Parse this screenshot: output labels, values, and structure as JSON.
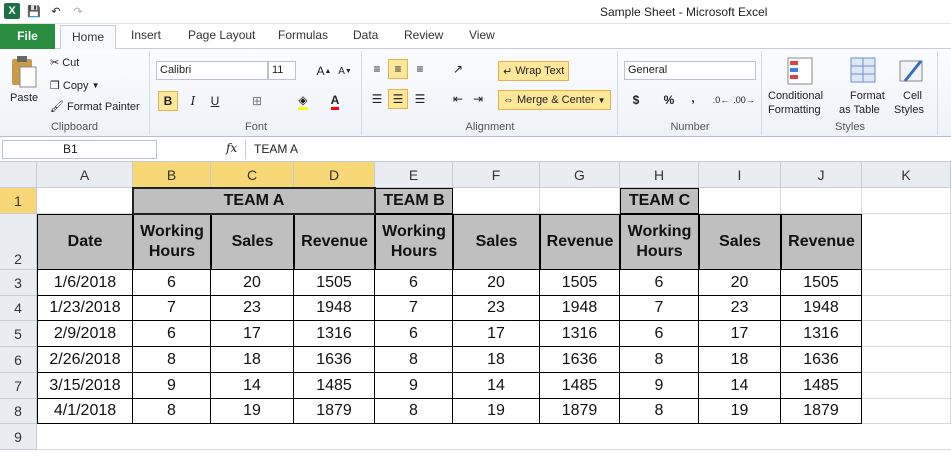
{
  "window": {
    "title": "Sample Sheet  -  Microsoft Excel"
  },
  "qat": {
    "logo": "X",
    "save": "💾",
    "undo": "↶",
    "redo": "↷"
  },
  "tabs": [
    "File",
    "Home",
    "Insert",
    "Page Layout",
    "Formulas",
    "Data",
    "Review",
    "View"
  ],
  "ribbon": {
    "clipboard": {
      "label": "Clipboard",
      "paste": "Paste",
      "cut": "Cut",
      "copy": "Copy",
      "format_painter": "Format Painter"
    },
    "font": {
      "label": "Font",
      "name": "Calibri",
      "size": "11",
      "bold": "B",
      "italic": "I",
      "underline": "U"
    },
    "alignment": {
      "label": "Alignment",
      "wrap_text": "Wrap Text",
      "merge_center": "Merge & Center"
    },
    "number": {
      "label": "Number",
      "format": "General",
      "currency": "$",
      "percent": "%",
      "comma": ","
    },
    "styles": {
      "label": "Styles",
      "conditional": "Conditional",
      "formatting": "Formatting",
      "format": "Format",
      "as_table": "as Table",
      "cell": "Cell",
      "styles": "Styles"
    }
  },
  "formula_bar": {
    "name_box": "B1",
    "fx": "fx",
    "content": "TEAM A"
  },
  "sheet": {
    "columns": [
      "A",
      "B",
      "C",
      "D",
      "E",
      "F",
      "G",
      "H",
      "I",
      "J",
      "K"
    ],
    "rows": [
      "1",
      "2",
      "3",
      "4",
      "5",
      "6",
      "7",
      "8",
      "9"
    ],
    "teams": [
      "TEAM A",
      "TEAM B",
      "TEAM C"
    ],
    "headers": [
      "Date",
      "Working Hours",
      "Sales",
      "Revenue",
      "Working Hours",
      "Sales",
      "Revenue",
      "Working Hours",
      "Sales",
      "Revenue"
    ],
    "data": [
      [
        "1/6/2018",
        "6",
        "20",
        "1505",
        "6",
        "20",
        "1505",
        "6",
        "20",
        "1505"
      ],
      [
        "1/23/2018",
        "7",
        "23",
        "1948",
        "7",
        "23",
        "1948",
        "7",
        "23",
        "1948"
      ],
      [
        "2/9/2018",
        "6",
        "17",
        "1316",
        "6",
        "17",
        "1316",
        "6",
        "17",
        "1316"
      ],
      [
        "2/26/2018",
        "8",
        "18",
        "1636",
        "8",
        "18",
        "1636",
        "8",
        "18",
        "1636"
      ],
      [
        "3/15/2018",
        "9",
        "14",
        "1485",
        "9",
        "14",
        "1485",
        "9",
        "14",
        "1485"
      ],
      [
        "4/1/2018",
        "8",
        "19",
        "1879",
        "8",
        "19",
        "1879",
        "8",
        "19",
        "1879"
      ]
    ]
  }
}
